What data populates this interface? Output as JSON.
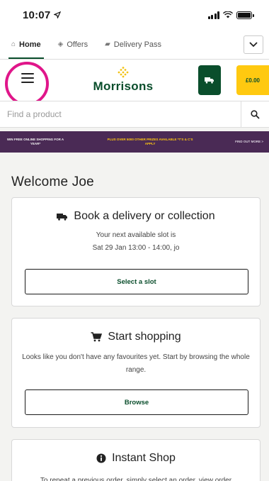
{
  "status_bar": {
    "time": "10:07"
  },
  "nav_tabs": [
    {
      "label": "Home",
      "icon": "home-icon"
    },
    {
      "label": "Offers",
      "icon": "tag-icon"
    },
    {
      "label": "Delivery Pass",
      "icon": "truck-icon"
    }
  ],
  "header": {
    "brand": "Morrisons",
    "cart_total": "£0.00"
  },
  "search": {
    "placeholder": "Find a product"
  },
  "promo": {
    "left": "WIN FREE ONLINE SHOPPING FOR A YEAR*",
    "middle": "PLUS OVER 5000 OTHER PRIZES AVAILABLE *T'S & C'S APPLY",
    "right": "FIND OUT MORE >"
  },
  "welcome": "Welcome Joe",
  "cards": {
    "delivery": {
      "title": "Book a delivery or collection",
      "line1": "Your next available slot is",
      "line2": "Sat 29 Jan 13:00 - 14:00, jo",
      "button": "Select a slot"
    },
    "shopping": {
      "title": "Start shopping",
      "text": "Looks like you don't have any favourites yet. Start by browsing the whole range.",
      "button": "Browse"
    },
    "instant": {
      "title": "Instant Shop",
      "text": "To repeat a previous order, simply select an order, view order"
    }
  },
  "colors": {
    "brand_green": "#0a4e2c",
    "brand_yellow": "#ffc910",
    "promo_purple": "#4a2a55",
    "highlight_pink": "#e0168a"
  }
}
